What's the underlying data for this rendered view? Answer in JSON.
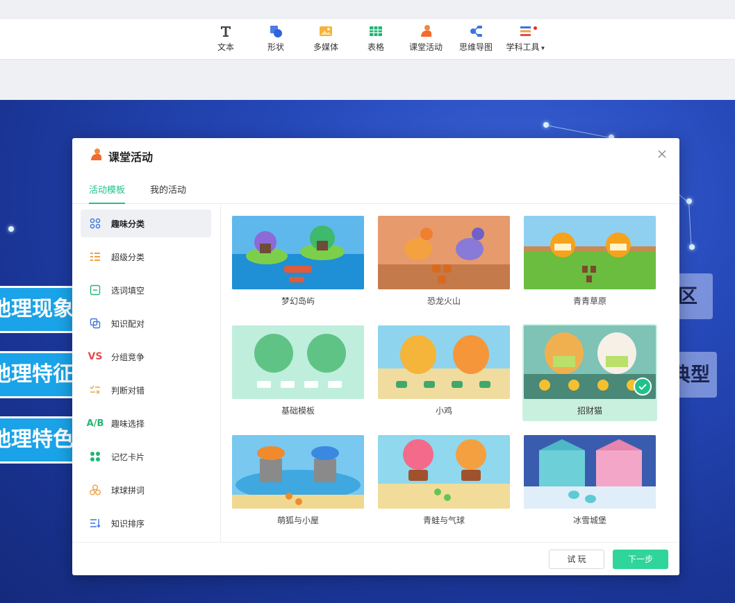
{
  "ribbon": {
    "tools": [
      {
        "id": "text",
        "label": "文本",
        "icon": "text-icon"
      },
      {
        "id": "shape",
        "label": "形状",
        "icon": "shape-icon"
      },
      {
        "id": "media",
        "label": "多媒体",
        "icon": "media-icon"
      },
      {
        "id": "table",
        "label": "表格",
        "icon": "table-icon"
      },
      {
        "id": "activity",
        "label": "课堂活动",
        "icon": "classroom-activity-icon"
      },
      {
        "id": "mindmap",
        "label": "思维导图",
        "icon": "mindmap-icon"
      },
      {
        "id": "subject",
        "label": "学科工具",
        "icon": "subject-tools-icon"
      }
    ]
  },
  "slide": {
    "tags": [
      "地理现象",
      "地理特征",
      "地理特色"
    ],
    "boxes": [
      "区",
      "典型"
    ]
  },
  "modal": {
    "title": "课堂活动",
    "tabs": [
      {
        "label": "活动模板",
        "active": true
      },
      {
        "label": "我的活动",
        "active": false
      }
    ],
    "sidebar": [
      {
        "label": "趣味分类",
        "icon": "grid-dots-icon",
        "active": true
      },
      {
        "label": "超级分类",
        "icon": "list-icon",
        "active": false
      },
      {
        "label": "选词填空",
        "icon": "fill-blank-icon",
        "active": false
      },
      {
        "label": "知识配对",
        "icon": "pairing-icon",
        "active": false
      },
      {
        "label": "分组竞争",
        "icon": "versus-icon",
        "active": false
      },
      {
        "label": "判断对错",
        "icon": "true-false-icon",
        "active": false
      },
      {
        "label": "趣味选择",
        "icon": "choice-icon",
        "active": false
      },
      {
        "label": "记忆卡片",
        "icon": "memory-cards-icon",
        "active": false
      },
      {
        "label": "球球拼词",
        "icon": "balls-icon",
        "active": false
      },
      {
        "label": "知识排序",
        "icon": "sort-icon",
        "active": false
      }
    ],
    "templates": [
      {
        "label": "梦幻岛屿",
        "selected": false
      },
      {
        "label": "恐龙火山",
        "selected": false
      },
      {
        "label": "青青草原",
        "selected": false
      },
      {
        "label": "基础模板",
        "selected": false
      },
      {
        "label": "小鸡",
        "selected": false
      },
      {
        "label": "招财猫",
        "selected": true
      },
      {
        "label": "萌狐与小屋",
        "selected": false
      },
      {
        "label": "青蛙与气球",
        "selected": false
      },
      {
        "label": "冰雪城堡",
        "selected": false
      }
    ],
    "footer": {
      "try_label": "试 玩",
      "next_label": "下一步"
    }
  },
  "colors": {
    "accent": "#1ec38b",
    "next_button": "#2fd59a",
    "selected_card": "#c9f0df"
  }
}
